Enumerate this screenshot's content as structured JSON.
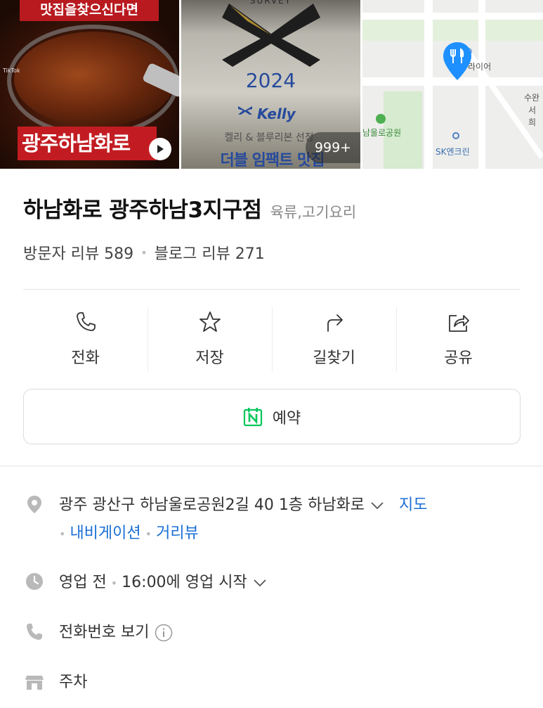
{
  "photos": {
    "photo1": {
      "top_banner": "맛집을찾으신다면",
      "bottom_text": "광주하남화로",
      "watermark": "TikTok"
    },
    "photo2": {
      "survey": "SURVEY",
      "year": "2024",
      "brand": "Kelly",
      "subtitle": "켈리 & 블루리본 선정",
      "bottom_text": "더블 임팩트 맛집",
      "photo_count": "999+"
    },
    "photo3": {
      "label_top": "라이어",
      "label_park": "남울로공원",
      "label_right1": "수완",
      "label_right2": "서희",
      "label_sk": "SK엔크린"
    }
  },
  "place": {
    "name": "하남화로 광주하남3지구점",
    "category": "육류,고기요리",
    "visitor_reviews": "방문자 리뷰 589",
    "blog_reviews": "블로그 리뷰 271"
  },
  "actions": [
    {
      "label": "전화",
      "icon": "phone-icon"
    },
    {
      "label": "저장",
      "icon": "star-icon"
    },
    {
      "label": "길찾기",
      "icon": "directions-icon"
    },
    {
      "label": "공유",
      "icon": "share-icon"
    }
  ],
  "reserve": {
    "label": "예약",
    "icon_letter": "N"
  },
  "info": {
    "address": "광주 광산구 하남울로공원2길 40 1층 하남화로",
    "map_link": "지도",
    "navigation_link": "내비게이션",
    "streetview_link": "거리뷰",
    "status": "영업 전",
    "hours": "16:00에 영업 시작",
    "phone": "전화번호 보기",
    "parking": "주차"
  },
  "colors": {
    "link": "#1a6fd6",
    "pin": "#1e90ff",
    "reserve_green": "#03c75a"
  }
}
